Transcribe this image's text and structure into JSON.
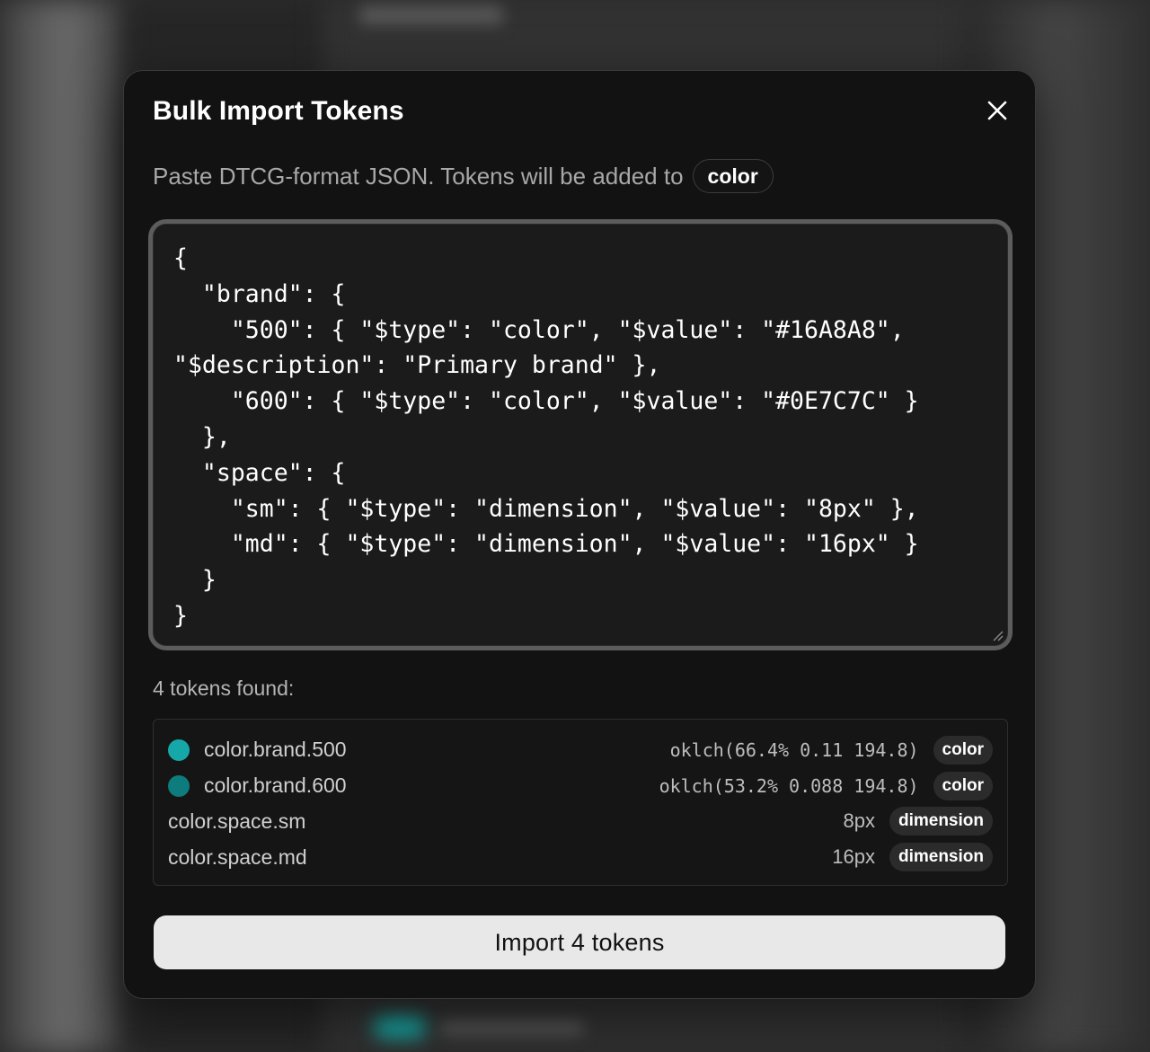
{
  "dialog": {
    "title": "Bulk Import Tokens",
    "subtitle": "Paste DTCG-format JSON. Tokens will be added to",
    "target_group": "color",
    "json_input": "{\n  \"brand\": {\n    \"500\": { \"$type\": \"color\", \"$value\": \"#16A8A8\", \"$description\": \"Primary brand\" },\n    \"600\": { \"$type\": \"color\", \"$value\": \"#0E7C7C\" }\n  },\n  \"space\": {\n    \"sm\": { \"$type\": \"dimension\", \"$value\": \"8px\" },\n    \"md\": { \"$type\": \"dimension\", \"$value\": \"16px\" }\n  }\n}",
    "found_label": "4 tokens found:",
    "tokens": [
      {
        "name": "color.brand.500",
        "value": "oklch(66.4% 0.11 194.8)",
        "type": "color",
        "swatch": "#16A8A8"
      },
      {
        "name": "color.brand.600",
        "value": "oklch(53.2% 0.088 194.8)",
        "type": "color",
        "swatch": "#0E7C7C"
      },
      {
        "name": "color.space.sm",
        "value": "8px",
        "type": "dimension"
      },
      {
        "name": "color.space.md",
        "value": "16px",
        "type": "dimension"
      }
    ],
    "import_button": "Import 4 tokens",
    "close_icon": "close-icon"
  }
}
